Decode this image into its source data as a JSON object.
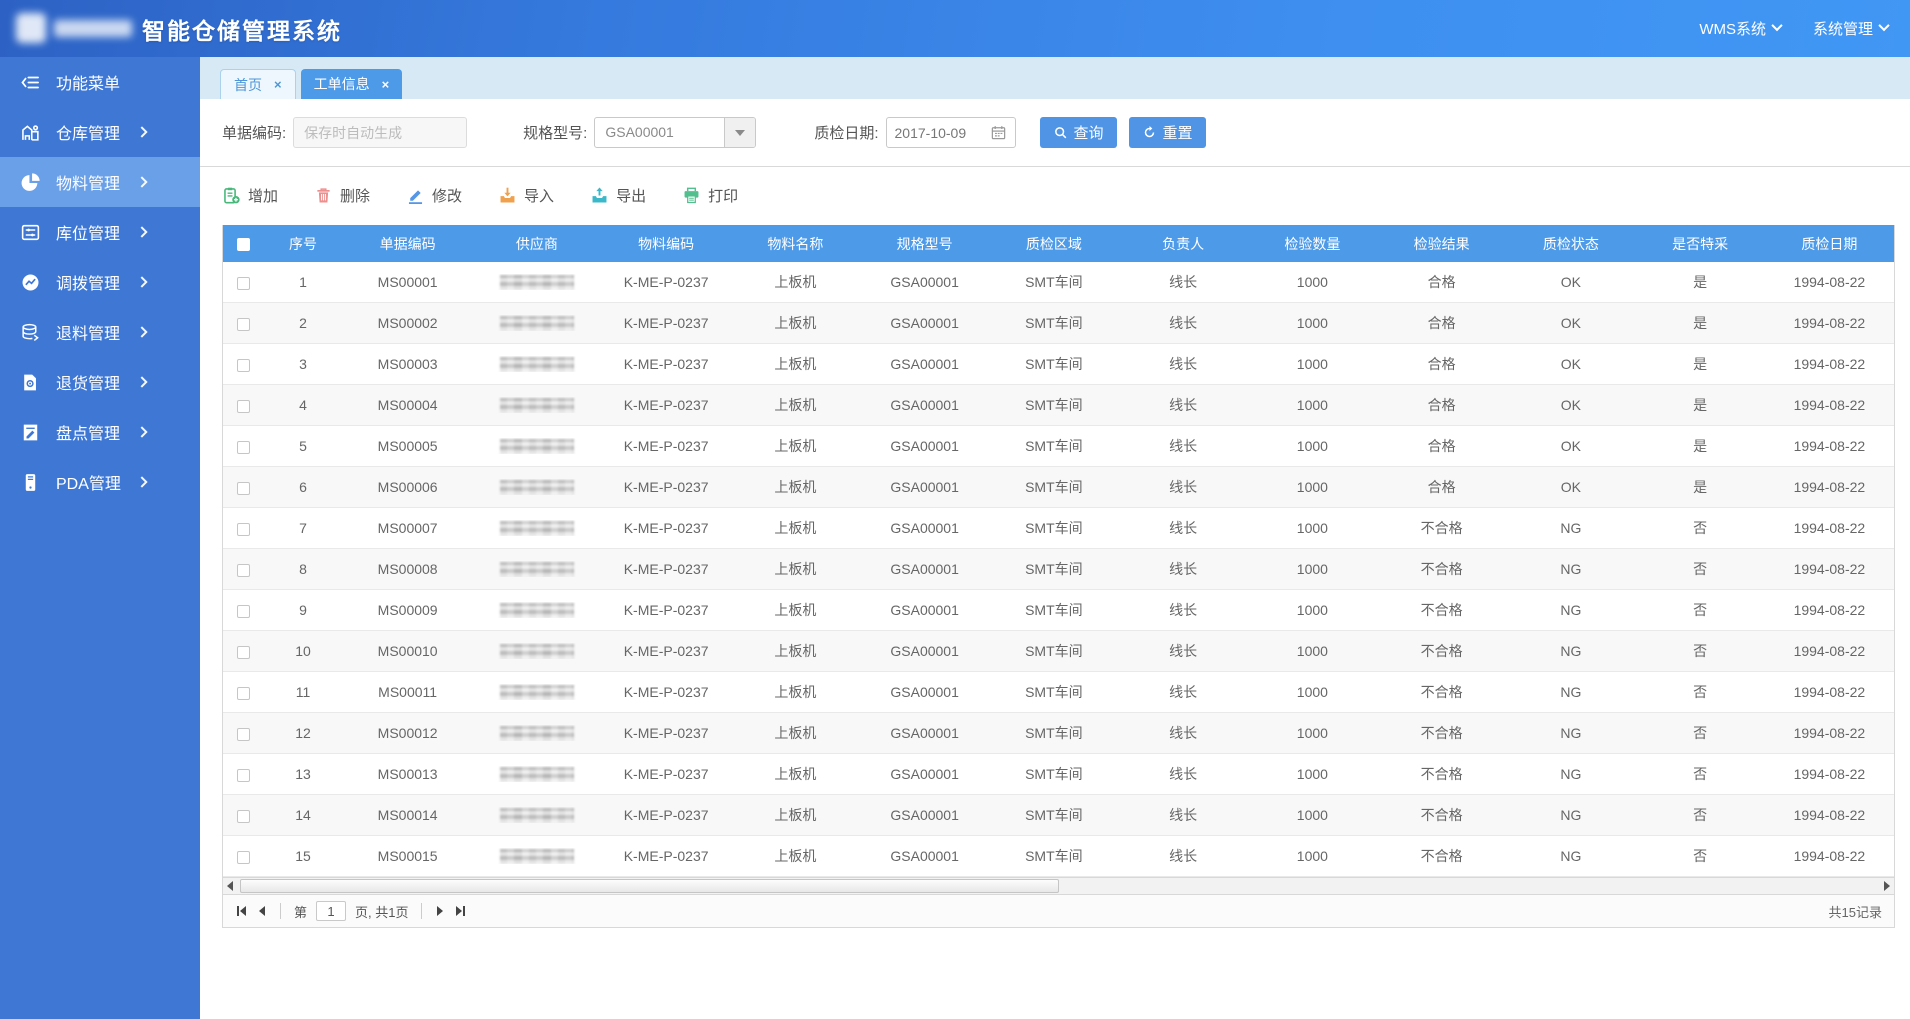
{
  "colors": {
    "header_gradient_start": "#2d62c4",
    "header_gradient_end": "#4197f4",
    "sidebar": "#3f78d4",
    "sidebar_active": "#6aa0e8",
    "accent_blue": "#4d9ae9",
    "tab_strip": "#d8e9f6",
    "icon_add": "#47b87a",
    "icon_delete": "#ec8f8f",
    "icon_edit": "#5596e6",
    "icon_import": "#f0a14e",
    "icon_export": "#3bb8c9",
    "icon_print": "#52c08e"
  },
  "header": {
    "title": "智能仓储管理系统",
    "menus": [
      {
        "label": "WMS系统",
        "icon": "chevron-down-icon"
      },
      {
        "label": "系统管理",
        "icon": "chevron-down-icon"
      }
    ]
  },
  "sidebar": {
    "items": [
      {
        "label": "功能菜单",
        "icon": "collapse-menu-icon",
        "active": false,
        "chevron": false
      },
      {
        "label": "仓库管理",
        "icon": "warehouse-icon",
        "active": false,
        "chevron": true
      },
      {
        "label": "物料管理",
        "icon": "pie-chart-icon",
        "active": true,
        "chevron": true
      },
      {
        "label": "库位管理",
        "icon": "sliders-icon",
        "active": false,
        "chevron": true
      },
      {
        "label": "调拨管理",
        "icon": "trend-circle-icon",
        "active": false,
        "chevron": true
      },
      {
        "label": "退料管理",
        "icon": "database-icon",
        "active": false,
        "chevron": true
      },
      {
        "label": "退货管理",
        "icon": "document-gear-icon",
        "active": false,
        "chevron": true
      },
      {
        "label": "盘点管理",
        "icon": "document-edit-icon",
        "active": false,
        "chevron": true
      },
      {
        "label": "PDA管理",
        "icon": "pda-device-icon",
        "active": false,
        "chevron": true
      }
    ]
  },
  "tabs": [
    {
      "label": "首页",
      "close": "×",
      "active": false
    },
    {
      "label": "工单信息",
      "close": "×",
      "active": true
    }
  ],
  "filters": {
    "order_code_label": "单据编码:",
    "order_code_placeholder": "保存时自动生成",
    "spec_label": "规格型号:",
    "spec_value": "GSA00001",
    "date_label": "质检日期:",
    "date_value": "2017-10-09",
    "search_label": "查询",
    "reset_label": "重置"
  },
  "toolbar": {
    "items": [
      {
        "label": "增加",
        "icon": "add-clipboard-icon"
      },
      {
        "label": "删除",
        "icon": "trash-icon"
      },
      {
        "label": "修改",
        "icon": "pencil-icon"
      },
      {
        "label": "导入",
        "icon": "import-icon"
      },
      {
        "label": "导出",
        "icon": "export-icon"
      },
      {
        "label": "打印",
        "icon": "printer-icon"
      }
    ]
  },
  "table": {
    "columns": [
      "序号",
      "单据编码",
      "供应商",
      "物料编码",
      "物料名称",
      "规格型号",
      "质检区域",
      "负责人",
      "检验数量",
      "检验结果",
      "质检状态",
      "是否特采",
      "质检日期"
    ],
    "column_keys": [
      "index",
      "order-code",
      "supplier",
      "material-code",
      "material-name",
      "spec-model",
      "qc-area",
      "manager",
      "qty",
      "result",
      "status",
      "special",
      "qc-date"
    ],
    "rows": [
      [
        "1",
        "MS00001",
        null,
        "K-ME-P-0237",
        "上板机",
        "GSA00001",
        "SMT车间",
        "线长",
        "1000",
        "合格",
        "OK",
        "是",
        "1994-08-22"
      ],
      [
        "2",
        "MS00002",
        null,
        "K-ME-P-0237",
        "上板机",
        "GSA00001",
        "SMT车间",
        "线长",
        "1000",
        "合格",
        "OK",
        "是",
        "1994-08-22"
      ],
      [
        "3",
        "MS00003",
        null,
        "K-ME-P-0237",
        "上板机",
        "GSA00001",
        "SMT车间",
        "线长",
        "1000",
        "合格",
        "OK",
        "是",
        "1994-08-22"
      ],
      [
        "4",
        "MS00004",
        null,
        "K-ME-P-0237",
        "上板机",
        "GSA00001",
        "SMT车间",
        "线长",
        "1000",
        "合格",
        "OK",
        "是",
        "1994-08-22"
      ],
      [
        "5",
        "MS00005",
        null,
        "K-ME-P-0237",
        "上板机",
        "GSA00001",
        "SMT车间",
        "线长",
        "1000",
        "合格",
        "OK",
        "是",
        "1994-08-22"
      ],
      [
        "6",
        "MS00006",
        null,
        "K-ME-P-0237",
        "上板机",
        "GSA00001",
        "SMT车间",
        "线长",
        "1000",
        "合格",
        "OK",
        "是",
        "1994-08-22"
      ],
      [
        "7",
        "MS00007",
        null,
        "K-ME-P-0237",
        "上板机",
        "GSA00001",
        "SMT车间",
        "线长",
        "1000",
        "不合格",
        "NG",
        "否",
        "1994-08-22"
      ],
      [
        "8",
        "MS00008",
        null,
        "K-ME-P-0237",
        "上板机",
        "GSA00001",
        "SMT车间",
        "线长",
        "1000",
        "不合格",
        "NG",
        "否",
        "1994-08-22"
      ],
      [
        "9",
        "MS00009",
        null,
        "K-ME-P-0237",
        "上板机",
        "GSA00001",
        "SMT车间",
        "线长",
        "1000",
        "不合格",
        "NG",
        "否",
        "1994-08-22"
      ],
      [
        "10",
        "MS00010",
        null,
        "K-ME-P-0237",
        "上板机",
        "GSA00001",
        "SMT车间",
        "线长",
        "1000",
        "不合格",
        "NG",
        "否",
        "1994-08-22"
      ],
      [
        "11",
        "MS00011",
        null,
        "K-ME-P-0237",
        "上板机",
        "GSA00001",
        "SMT车间",
        "线长",
        "1000",
        "不合格",
        "NG",
        "否",
        "1994-08-22"
      ],
      [
        "12",
        "MS00012",
        null,
        "K-ME-P-0237",
        "上板机",
        "GSA00001",
        "SMT车间",
        "线长",
        "1000",
        "不合格",
        "NG",
        "否",
        "1994-08-22"
      ],
      [
        "13",
        "MS00013",
        null,
        "K-ME-P-0237",
        "上板机",
        "GSA00001",
        "SMT车间",
        "线长",
        "1000",
        "不合格",
        "NG",
        "否",
        "1994-08-22"
      ],
      [
        "14",
        "MS00014",
        null,
        "K-ME-P-0237",
        "上板机",
        "GSA00001",
        "SMT车间",
        "线长",
        "1000",
        "不合格",
        "NG",
        "否",
        "1994-08-22"
      ],
      [
        "15",
        "MS00015",
        null,
        "K-ME-P-0237",
        "上板机",
        "GSA00001",
        "SMT车间",
        "线长",
        "1000",
        "不合格",
        "NG",
        "否",
        "1994-08-22"
      ]
    ]
  },
  "pagination": {
    "page_prefix": "第",
    "page_value": "1",
    "page_suffix": "页, 共1页",
    "total_label": "共15记录"
  }
}
